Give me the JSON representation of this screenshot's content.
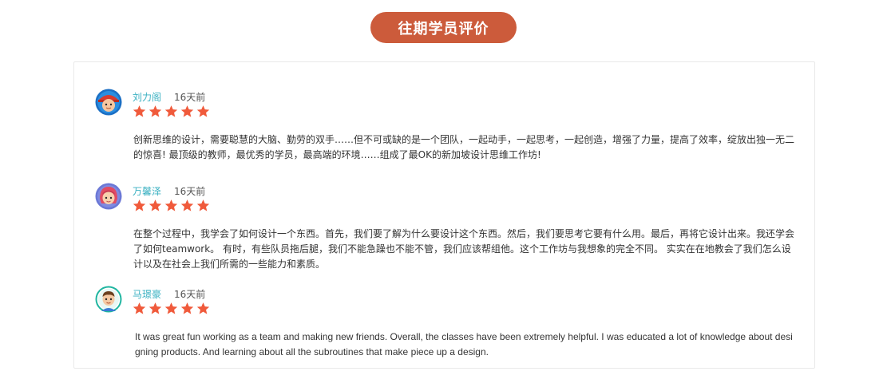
{
  "header": {
    "title": "往期学员评价"
  },
  "colors": {
    "accent": "#cc5b3b",
    "name": "#3bb1c2",
    "star": "#f05a3b",
    "text": "#333333"
  },
  "reviews": [
    {
      "name": "刘力阁",
      "time": "16天前",
      "rating": 5,
      "avatar_icon": "avatar-blue-cap-icon",
      "text": "创新思维的设计，需要聪慧的大脑、勤劳的双手……但不可或缺的是一个团队，一起动手，一起思考，一起创造，增强了力量，提高了效率，绽放出独一无二的惊喜! 最顶级的教师，最优秀的学员，最高端的环境……组成了最OK的新加坡设计思维工作坊!"
    },
    {
      "name": "万馨泽",
      "time": "16天前",
      "rating": 5,
      "avatar_icon": "avatar-girl-pink-icon",
      "text": "在整个过程中，我学会了如何设计一个东西。首先，我们要了解为什么要设计这个东西。然后，我们要思考它要有什么用。最后，再将它设计出来。我还学会了如何teamwork。 有时，有些队员拖后腿，我们不能急躁也不能不管，我们应该帮组他。这个工作坊与我想象的完全不同。 实实在在地教会了我们怎么设计以及在社会上我们所需的一些能力和素质。"
    },
    {
      "name": "马璟豪",
      "time": "16天前",
      "rating": 5,
      "avatar_icon": "avatar-boy-teal-icon",
      "text": "It was great fun working as a team and making new friends. Overall, the classes have been extremely helpful. I was educated a lot of knowledge about designing products. And learning about all the subroutines that make piece up a design."
    }
  ]
}
